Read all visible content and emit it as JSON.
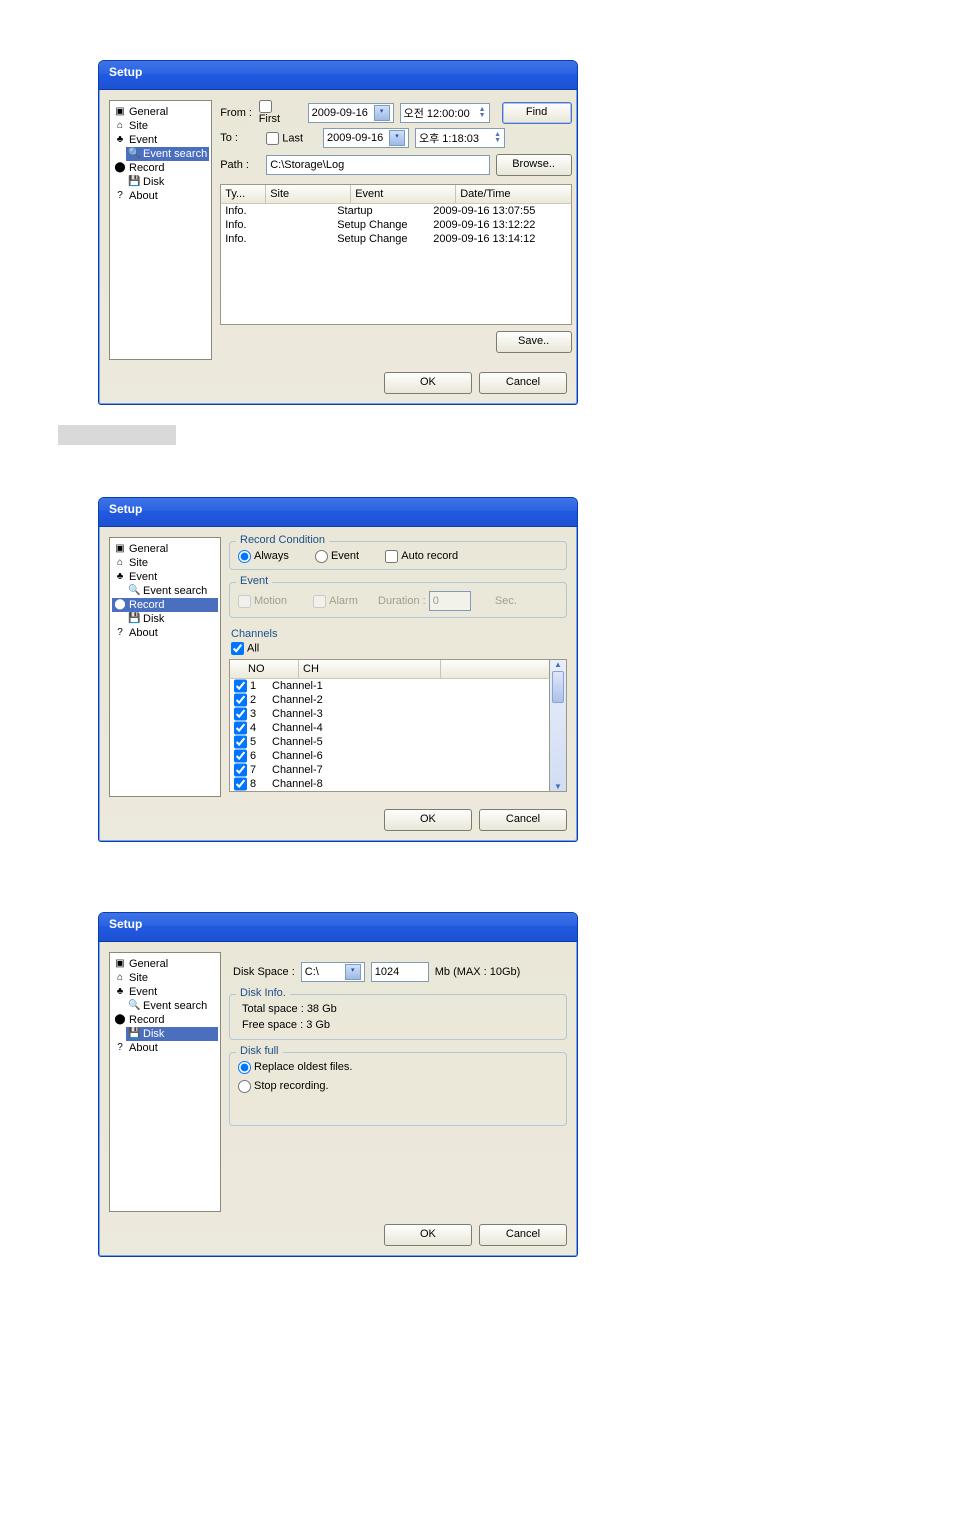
{
  "title": "Setup",
  "tree": {
    "general": "General",
    "site": "Site",
    "event": "Event",
    "event_search": "Event search",
    "record": "Record",
    "disk": "Disk",
    "about": "About"
  },
  "win1": {
    "from_lbl": "From :",
    "to_lbl": "To    :",
    "first_lbl": "First",
    "last_lbl": "Last",
    "date_from": "2009-09-16",
    "date_to": "2009-09-16",
    "time_from": "오전 12:00:00",
    "time_to": "오후  1:18:03",
    "find_btn": "Find",
    "path_lbl": "Path :",
    "path_val": "C:\\Storage\\Log",
    "browse_btn": "Browse..",
    "cols": {
      "type": "Ty...",
      "site": "Site",
      "event": "Event",
      "dt": "Date/Time"
    },
    "rows": [
      {
        "type": "Info.",
        "site": "",
        "event": "Startup",
        "dt": "2009-09-16 13:07:55"
      },
      {
        "type": "Info.",
        "site": "",
        "event": "Setup Change",
        "dt": "2009-09-16 13:12:22"
      },
      {
        "type": "Info.",
        "site": "",
        "event": "Setup Change",
        "dt": "2009-09-16 13:14:12"
      }
    ],
    "save_btn": "Save.."
  },
  "win2": {
    "rc_lbl": "Record Condition",
    "always": "Always",
    "event": "Event",
    "auto": "Auto record",
    "ev_lbl": "Event",
    "motion": "Motion",
    "alarm": "Alarm",
    "dur_lbl": "Duration :",
    "dur_val": "0",
    "sec": "Sec.",
    "ch_lbl": "Channels",
    "all": "All",
    "cols": {
      "no": "NO",
      "ch": "CH"
    },
    "rows": [
      {
        "no": "1",
        "ch": "Channel-1"
      },
      {
        "no": "2",
        "ch": "Channel-2"
      },
      {
        "no": "3",
        "ch": "Channel-3"
      },
      {
        "no": "4",
        "ch": "Channel-4"
      },
      {
        "no": "5",
        "ch": "Channel-5"
      },
      {
        "no": "6",
        "ch": "Channel-6"
      },
      {
        "no": "7",
        "ch": "Channel-7"
      },
      {
        "no": "8",
        "ch": "Channel-8"
      }
    ]
  },
  "win3": {
    "ds_lbl": "Disk Space :",
    "drive": "C:\\",
    "size": "1024",
    "unit": "Mb (MAX : 10Gb)",
    "di_lbl": "Disk Info.",
    "total": "Total space : 38 Gb",
    "free": "Free space : 3 Gb",
    "df_lbl": "Disk full",
    "replace": "Replace oldest files.",
    "stop": "Stop recording."
  },
  "ok": "OK",
  "cancel": "Cancel"
}
